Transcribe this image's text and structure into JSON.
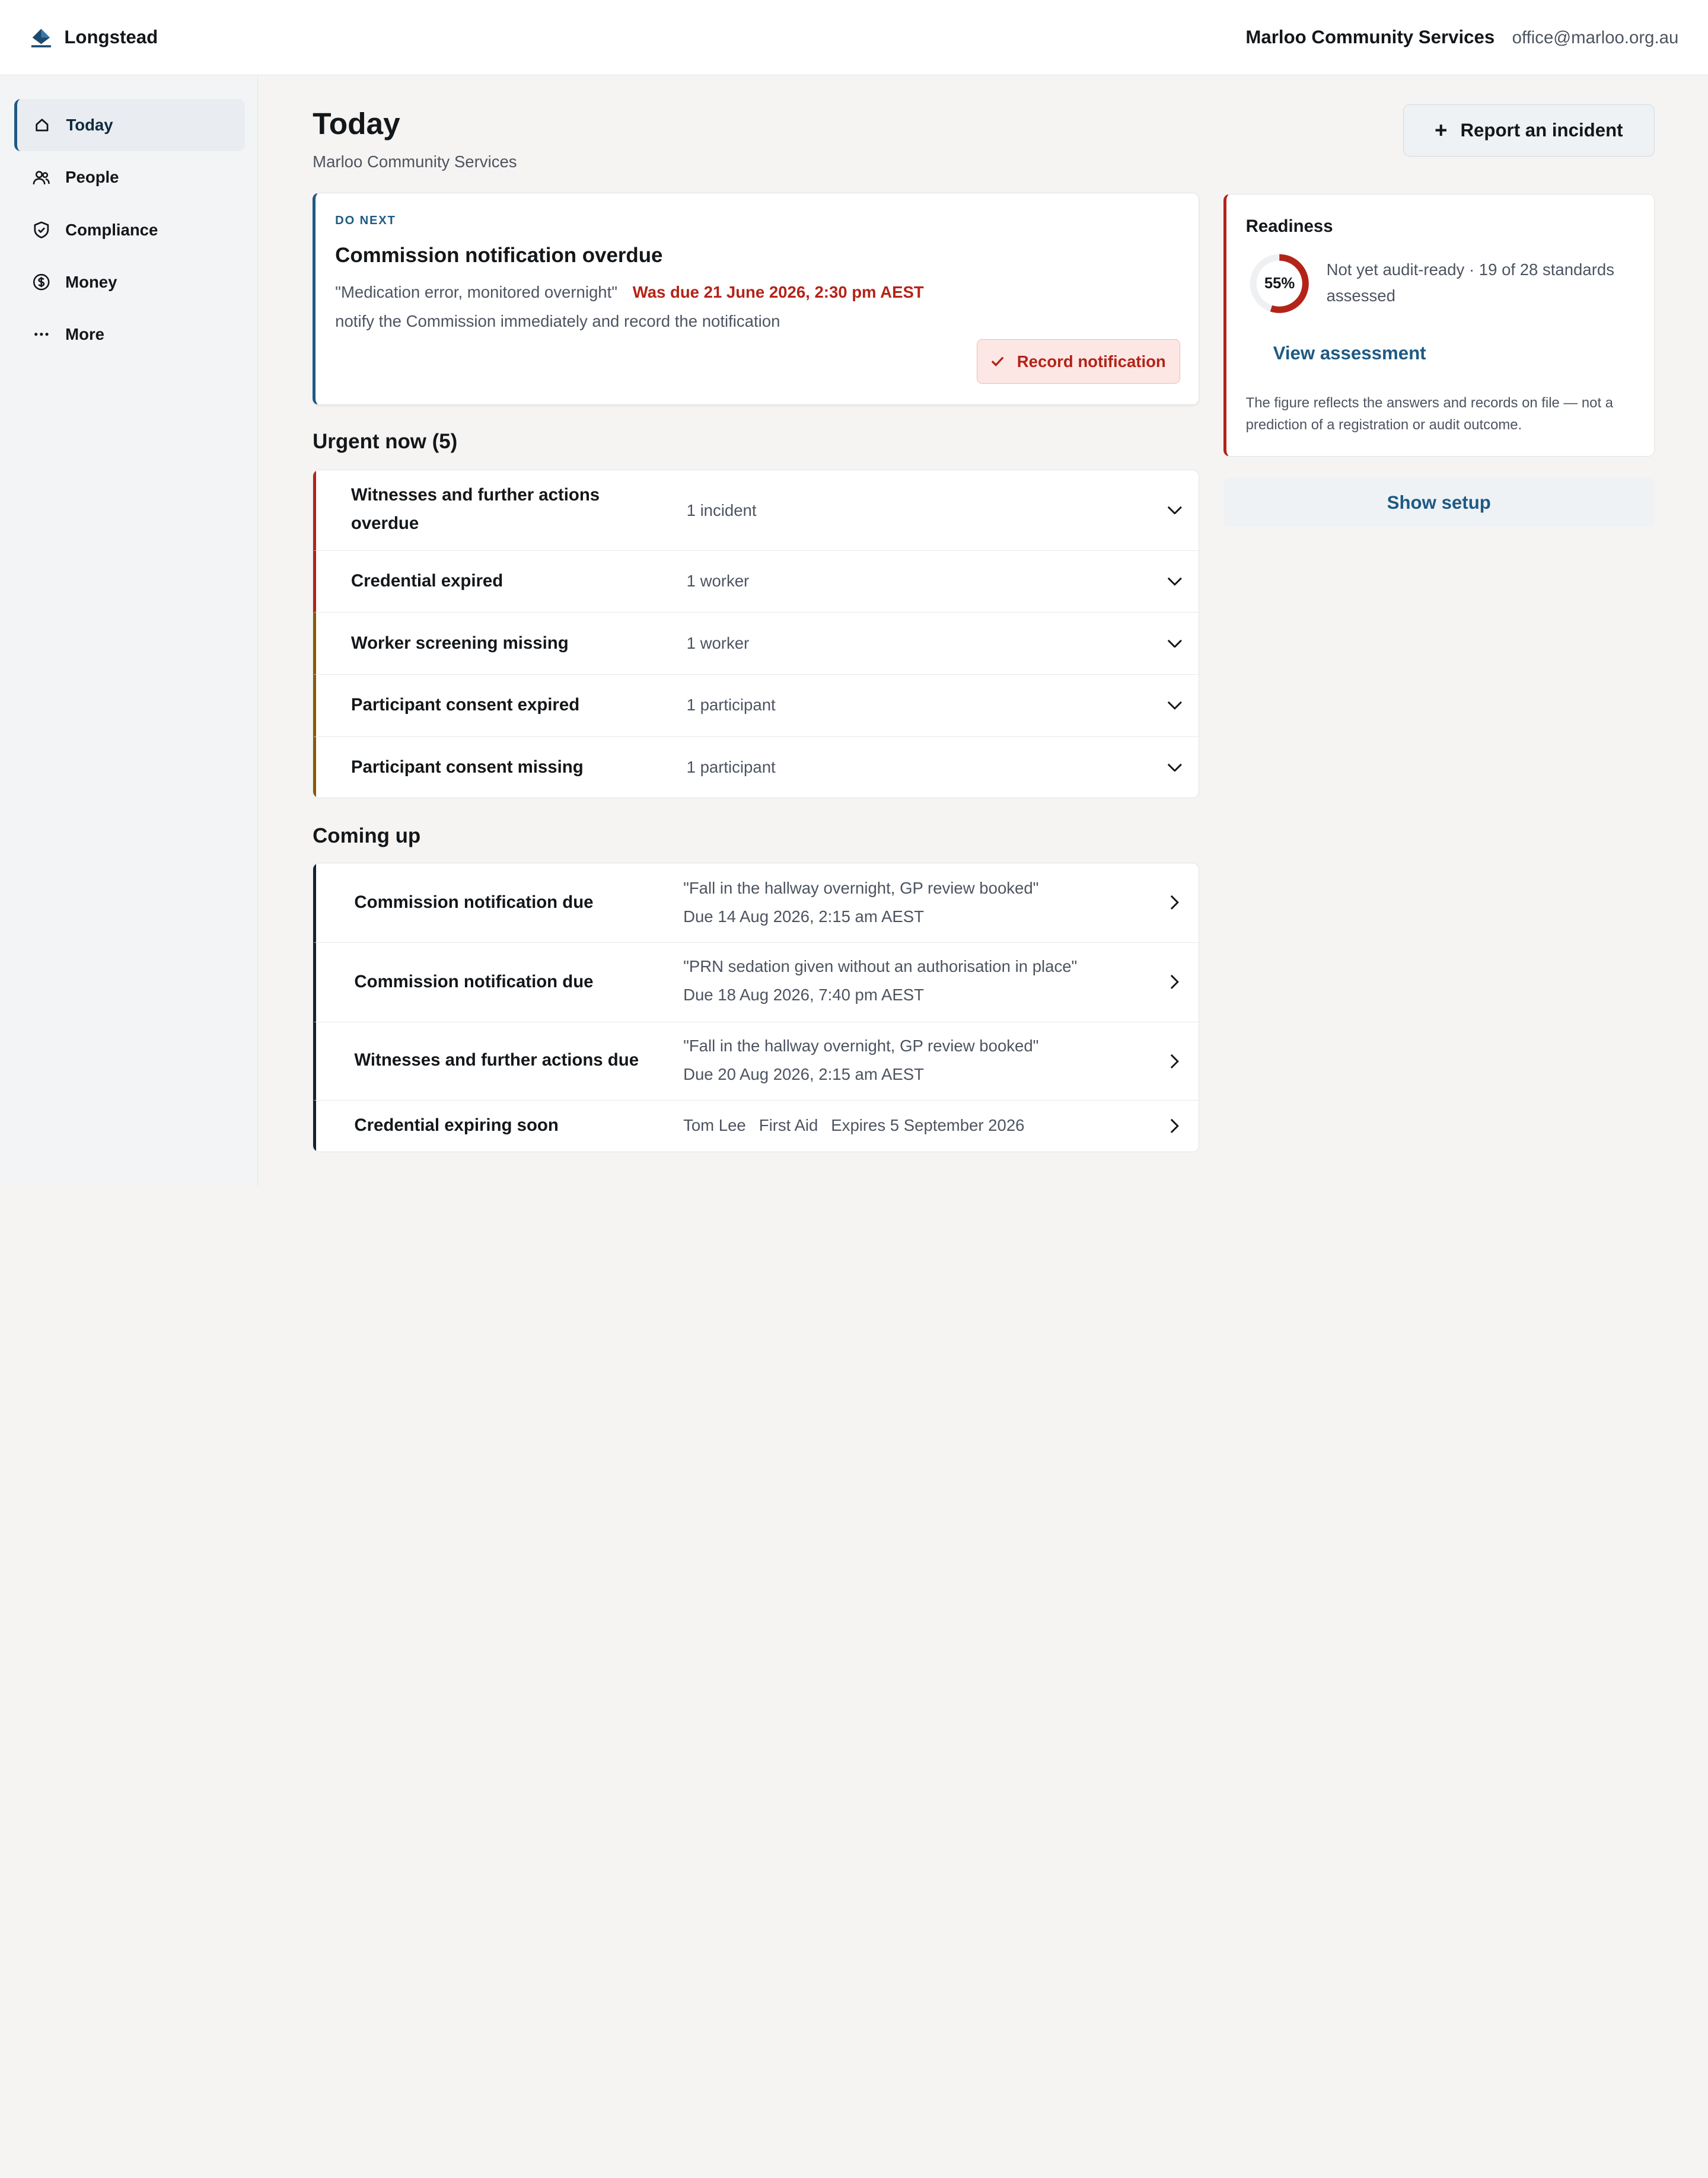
{
  "app": {
    "brand_name": "Longstead",
    "org_name": "Marloo Community Services",
    "org_email": "office@marloo.org.au"
  },
  "sidebar": {
    "items": [
      {
        "label": "Today",
        "icon": "home-icon",
        "active": true
      },
      {
        "label": "People",
        "icon": "people-icon"
      },
      {
        "label": "Compliance",
        "icon": "shield-check-icon"
      },
      {
        "label": "Money",
        "icon": "dollar-circle-icon"
      },
      {
        "label": "More",
        "icon": "ellipsis-icon"
      }
    ]
  },
  "page": {
    "title": "Today",
    "subtitle": "Marloo Community Services",
    "report_button": "Report an incident"
  },
  "do_next": {
    "eyebrow": "DO NEXT",
    "title": "Commission notification overdue",
    "quote": "\"Medication error, monitored overnight\"",
    "due": "Was due 21 June 2026, 2:30 pm AEST",
    "description": "notify the Commission immediately and record the notification",
    "action": "Record notification"
  },
  "urgent": {
    "heading": "Urgent now (5)",
    "rows": [
      {
        "title": "Witnesses and further actions overdue",
        "meta": "1 incident"
      },
      {
        "title": "Credential expired",
        "meta": "1 worker"
      },
      {
        "title": "Worker screening missing",
        "meta": "1 worker"
      },
      {
        "title": "Participant consent expired",
        "meta": "1 participant"
      },
      {
        "title": "Participant consent missing",
        "meta": "1 participant"
      }
    ]
  },
  "coming_up": {
    "heading": "Coming up",
    "rows": [
      {
        "title": "Commission notification due",
        "quote": "\"Fall in the hallway overnight, GP review booked\"",
        "due": "Due 14 Aug 2026, 2:15 am AEST"
      },
      {
        "title": "Commission notification due",
        "quote": "\"PRN sedation given without an authorisation in place\"",
        "due": "Due 18 Aug 2026, 7:40 pm AEST"
      },
      {
        "title": "Witnesses and further actions due",
        "quote": "\"Fall in the hallway overnight, GP review booked\"",
        "due": "Due 20 Aug 2026, 2:15 am AEST"
      },
      {
        "title": "Credential expiring soon",
        "person": "Tom Lee",
        "credential": "First Aid",
        "expires": "Expires 5 September 2026"
      }
    ]
  },
  "readiness": {
    "heading": "Readiness",
    "percent_label": "55%",
    "percent_value": 0.55,
    "status": "Not yet audit-ready · 19 of 28 standards assessed",
    "link": "View assessment",
    "note": "The figure reflects the answers and records on file — not a prediction of a registration or audit outcome.",
    "setup_button": "Show setup"
  },
  "colors": {
    "accent": "#1e5a84",
    "urgent": "#b42318",
    "warning": "#8a5a00",
    "dark": "#14232f"
  }
}
